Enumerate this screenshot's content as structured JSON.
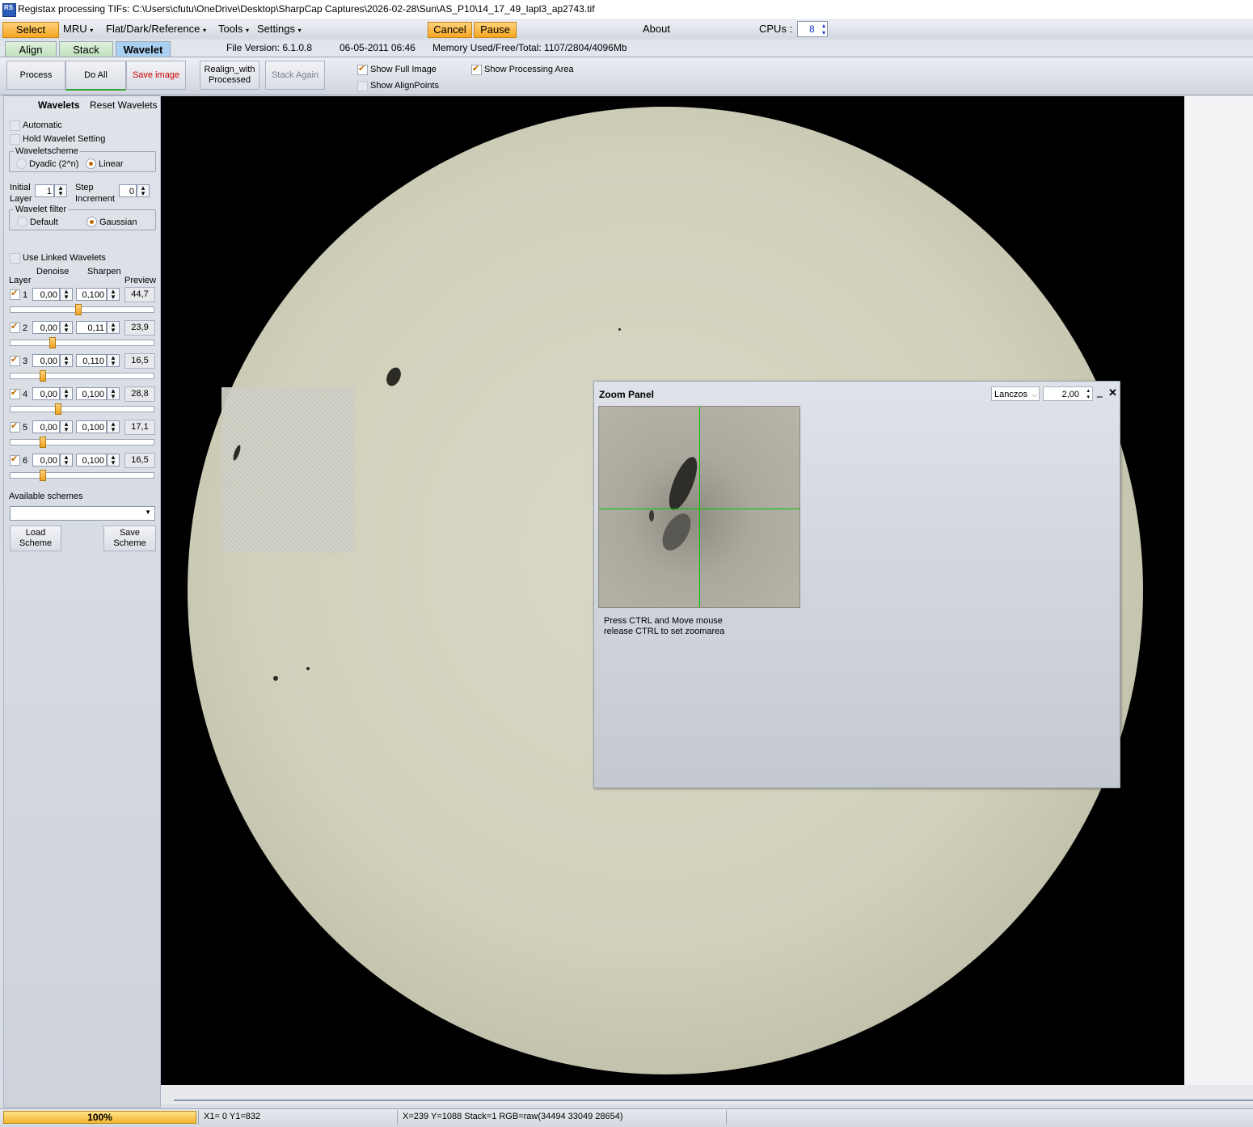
{
  "window": {
    "title": "Registax processing TIFs: C:\\Users\\cfutu\\OneDrive\\Desktop\\SharpCap Captures\\2026-02-28\\Sun\\AS_P10\\14_17_49_lapl3_ap2743.tif",
    "icon_text": "RS"
  },
  "menu": {
    "select": "Select",
    "mru": "MRU",
    "flat": "Flat/Dark/Reference",
    "tools": "Tools",
    "settings": "Settings",
    "cancel": "Cancel",
    "pause": "Pause",
    "about": "About",
    "cpus_label": "CPUs :",
    "cpus_value": "8"
  },
  "tabs": {
    "align": "Align",
    "stack": "Stack",
    "wavelet": "Wavelet"
  },
  "info": {
    "file_version": "File Version: 6.1.0.8",
    "date": "06-05-2011 06:46",
    "memory": "Memory Used/Free/Total: 1107/2804/4096Mb"
  },
  "toolbar": {
    "process": "Process",
    "do_all": "Do All",
    "save_image": "Save image",
    "realign_l1": "Realign_with",
    "realign_l2": "Processed",
    "stack_again": "Stack Again",
    "show_full_image": "Show Full Image",
    "show_alignpoints": "Show AlignPoints",
    "show_processing_area": "Show Processing Area"
  },
  "wavelets": {
    "header": "Wavelets",
    "reset": "Reset Wavelets",
    "automatic": "Automatic",
    "hold": "Hold Wavelet Setting",
    "scheme_title": "Waveletscheme",
    "dyadic": "Dyadic (2^n)",
    "linear": "Linear",
    "initial_l1": "Initial",
    "initial_l2": "Layer",
    "initial_value": "1",
    "step_l1": "Step",
    "step_l2": "Increment",
    "step_value": "0",
    "filter_title": "Wavelet filter",
    "default": "Default",
    "gaussian": "Gaussian",
    "use_linked": "Use Linked Wavelets",
    "col_denoise": "Denoise",
    "col_sharpen": "Sharpen",
    "col_layer": "Layer",
    "col_preview": "Preview",
    "layers": [
      {
        "n": "1",
        "denoise": "0,00",
        "sharpen": "0,100",
        "preview": "44,7",
        "slider": 0.47
      },
      {
        "n": "2",
        "denoise": "0,00",
        "sharpen": "0,11",
        "preview": "23,9",
        "slider": 0.28
      },
      {
        "n": "3",
        "denoise": "0,00",
        "sharpen": "0,110",
        "preview": "16,5",
        "slider": 0.21
      },
      {
        "n": "4",
        "denoise": "0,00",
        "sharpen": "0,100",
        "preview": "28,8",
        "slider": 0.32
      },
      {
        "n": "5",
        "denoise": "0,00",
        "sharpen": "0,100",
        "preview": "17,1",
        "slider": 0.21
      },
      {
        "n": "6",
        "denoise": "0,00",
        "sharpen": "0,100",
        "preview": "16,5",
        "slider": 0.21
      }
    ],
    "available_schemes": "Available schemes",
    "scheme_value": "",
    "load_l1": "Load",
    "load_l2": "Scheme",
    "save_l1": "Save",
    "save_l2": "Scheme"
  },
  "zoom": {
    "title": "Zoom Panel",
    "filter": "Lanczos",
    "factor": "2,00",
    "hint_l1": "Press CTRL and Move mouse",
    "hint_l2": "release CTRL to set zoomarea"
  },
  "status": {
    "progress": "100%",
    "coords1": "X1= 0 Y1=832",
    "coords2": "X=239 Y=1088 Stack=1 RGB=raw(34494 33049 28654)"
  },
  "colors": {
    "accent_orange": "#f5a623",
    "crosshair": "#00c800",
    "wavelet_tab": "#a9d0f0"
  }
}
